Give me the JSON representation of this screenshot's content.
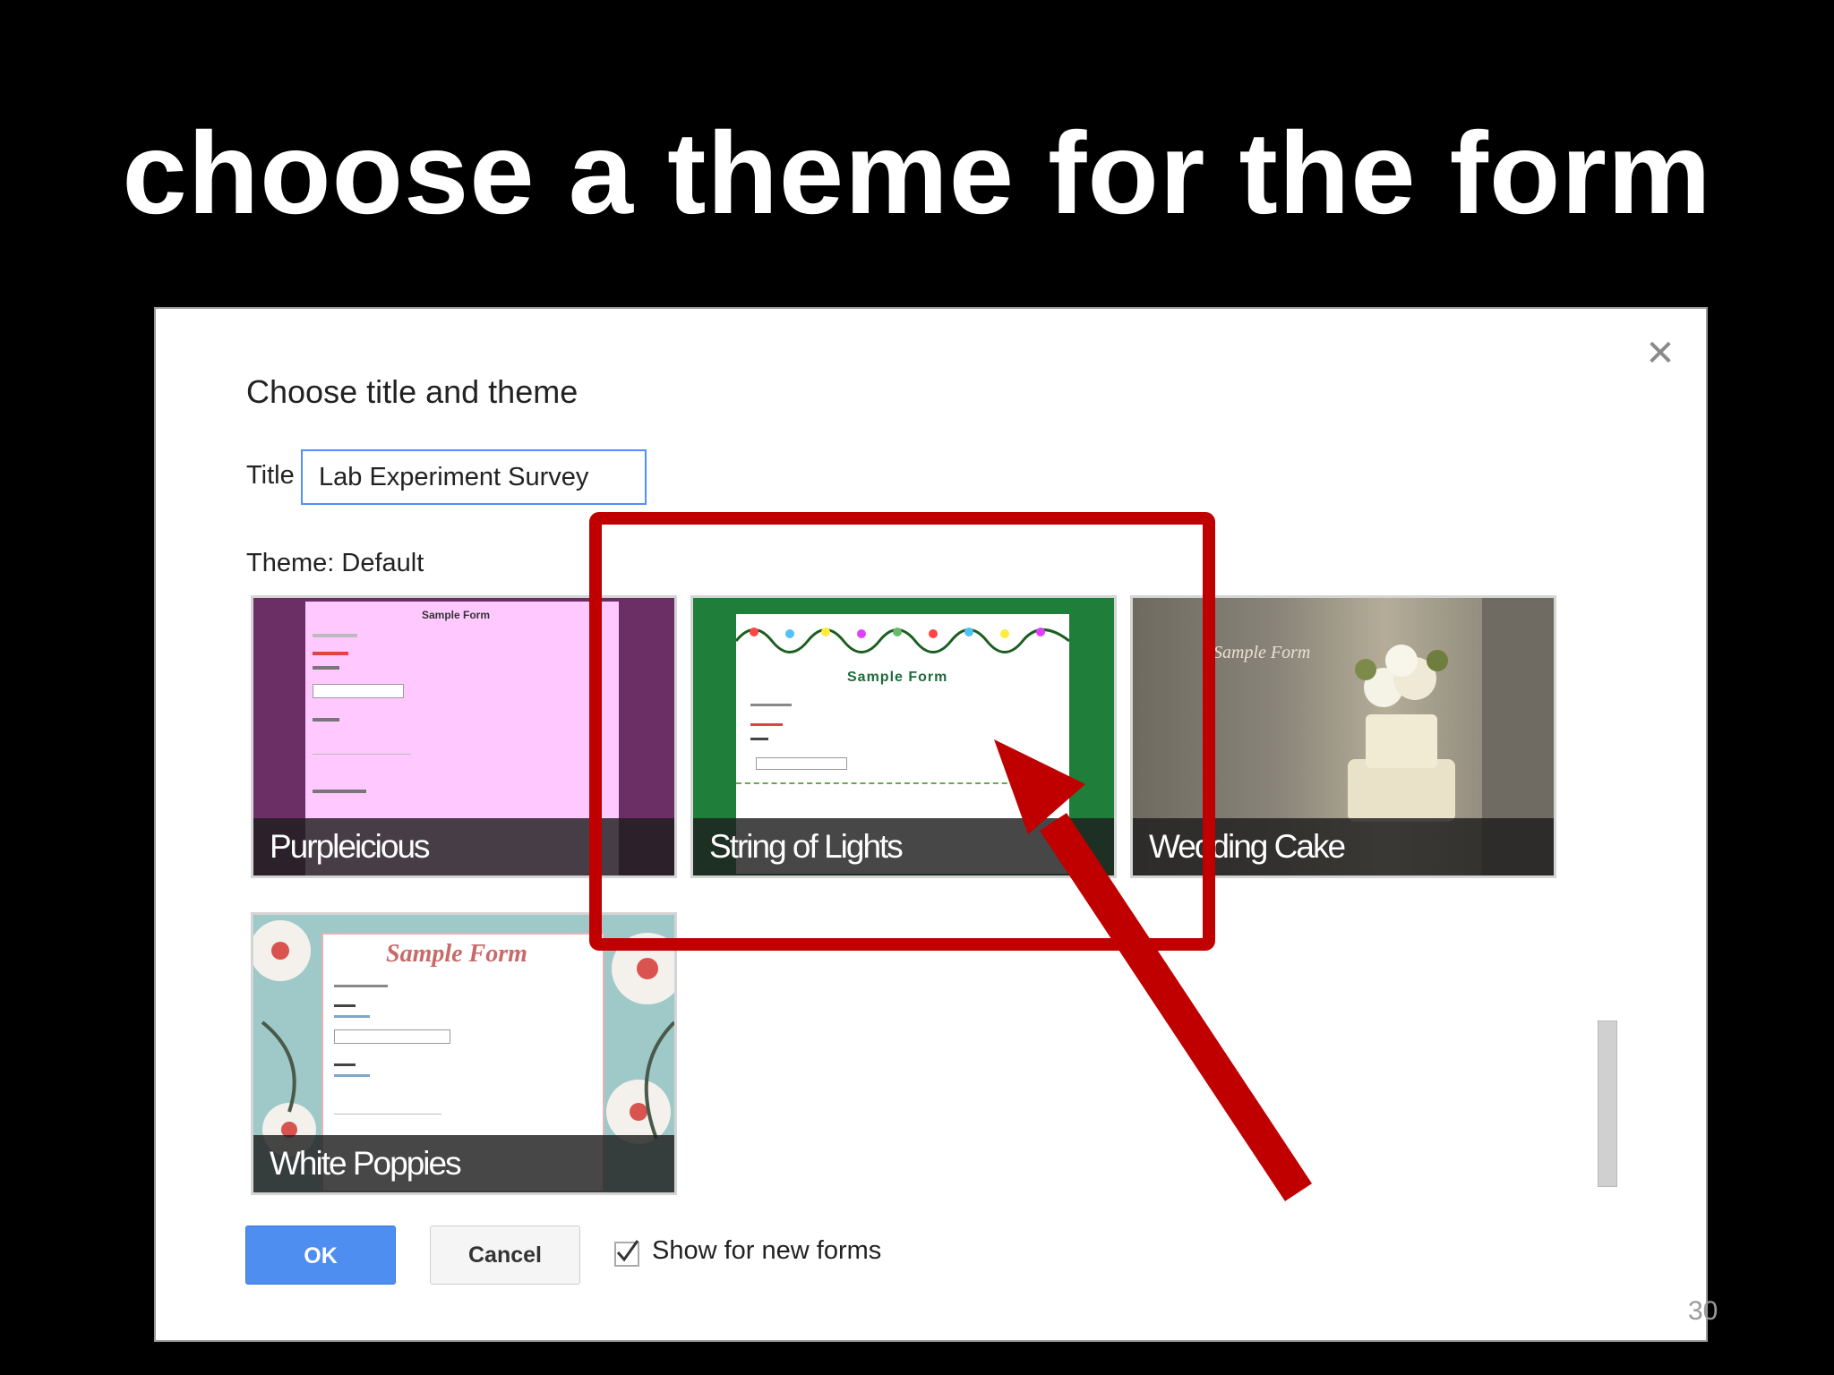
{
  "slide": {
    "title": "choose a theme for the form",
    "page_number": "30"
  },
  "dialog": {
    "heading": "Choose title and theme",
    "close_glyph": "✕",
    "title_label": "Title",
    "title_value": "Lab Experiment Survey",
    "theme_label": "Theme: Default",
    "themes": [
      {
        "name": "Purpleicious",
        "preview_title": "Sample Form"
      },
      {
        "name": "String of Lights",
        "preview_title": "Sample Form"
      },
      {
        "name": "Wedding Cake",
        "preview_title": "Sample Form"
      },
      {
        "name": "White Poppies",
        "preview_title": "Sample Form"
      }
    ],
    "ok_label": "OK",
    "cancel_label": "Cancel",
    "show_label": "Show for new forms",
    "show_checked": true
  },
  "annotation": {
    "color": "#c00000"
  },
  "colors": {
    "ok": "#4d8ef0",
    "input_border": "#4d90fe",
    "purple": "#6b2f66",
    "pink": "#ffc9ff",
    "green": "#1f7f3a"
  }
}
